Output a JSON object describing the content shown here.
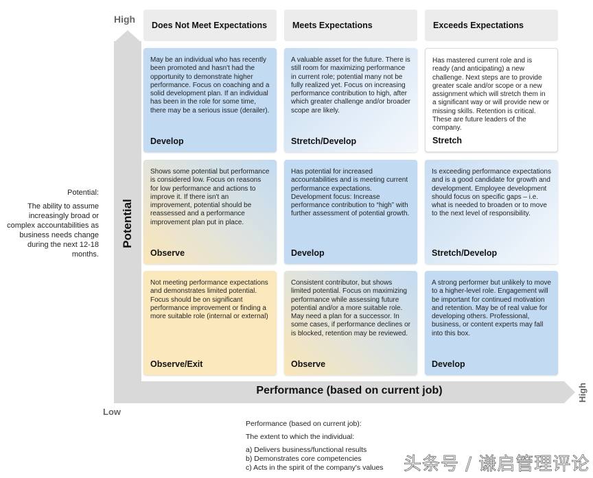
{
  "axes": {
    "potential": {
      "label": "Potential",
      "high": "High",
      "low": "Low"
    },
    "performance": {
      "label": "Performance (based on current job)",
      "high": "High"
    }
  },
  "columns": [
    {
      "label": "Does Not Meet Expectations"
    },
    {
      "label": "Meets Expectations"
    },
    {
      "label": "Exceeds Expectations"
    }
  ],
  "grid": [
    [
      {
        "text": "May be an individual who has recently been promoted and hasn't had the opportunity to demonstrate higher performance. Focus on coaching and a solid development plan. If an individual has been in the role for some time, there may be a serious issue (derailer).",
        "action": "Develop",
        "color": "#c2dbf2"
      },
      {
        "text": "A valuable asset for the future. There is still room for maximizing performance in current role; potential many not be fully realized yet. Focus on increasing performance contribution to high, after which greater challenge and/or broader scope are likely.",
        "action": "Stretch/Develop",
        "color": "#dbe8f5"
      },
      {
        "text": "Has mastered current role and is ready (and anticipating) a new challenge. Next steps are to provide greater scale and/or scope or a new assignment which will stretch them in a significant way or will provide new or missing skills. Retention is critical. These are future leaders of the company.",
        "action": "Stretch",
        "color": "#ffffff"
      }
    ],
    [
      {
        "text": "Shows some potential but performance is considered low. Focus on reasons for low performance and actions to improve it. If there isn't an improvement, potential should be reassessed and a performance improvement plan put in place.",
        "action": "Observe",
        "color": "#e5e3d5"
      },
      {
        "text": "Has potential for increased accountabilities and is meeting current performance expectations. Development focus: Increase performance contribution to “high” with further assessment of potential growth.",
        "action": "Develop",
        "color": "#c2dbf2"
      },
      {
        "text": "Is exceeding performance expectations and is a good candidate for growth and development. Employee development should focus on specific gaps – i.e. what is needed to broaden or to move to the next level of responsibility.",
        "action": "Stretch/Develop",
        "color": "#dbe8f5"
      }
    ],
    [
      {
        "text": "Not meeting performance expectations and demonstrates limited potential. Focus should be on significant performance improvement or finding a more suitable role (internal or external)",
        "action": "Observe/Exit",
        "color": "#fce8bd"
      },
      {
        "text": "Consistent contributor, but shows limited potential. Focus on maximizing performance while assessing future potential and/or a more suitable role. May need a plan for a successor. In some cases, if performance declines or is blocked, retention may be reviewed.",
        "action": "Observe",
        "color": "#e5e3d5"
      },
      {
        "text": "A strong performer but unlikely to move to a higher-level role. Engagement will be important for continued motivation and retention. May be of real value for developing others. Professional, business, or content experts may fall into this box.",
        "action": "Develop",
        "color": "#c2dbf2"
      }
    ]
  ],
  "potential_definition": {
    "title": "Potential:",
    "body": "The ability to assume increasingly broad or complex accountabilities as business needs change during the next 12-18 months."
  },
  "performance_definition": {
    "title": "Performance (based on current job):",
    "intro": "The extent to which the individual:",
    "items": [
      "a) Delivers business/functional results",
      "b) Demonstrates core competencies",
      "c) Acts in the spirit of the company's values"
    ]
  },
  "watermark": "头条号 / 谦启管理评论"
}
